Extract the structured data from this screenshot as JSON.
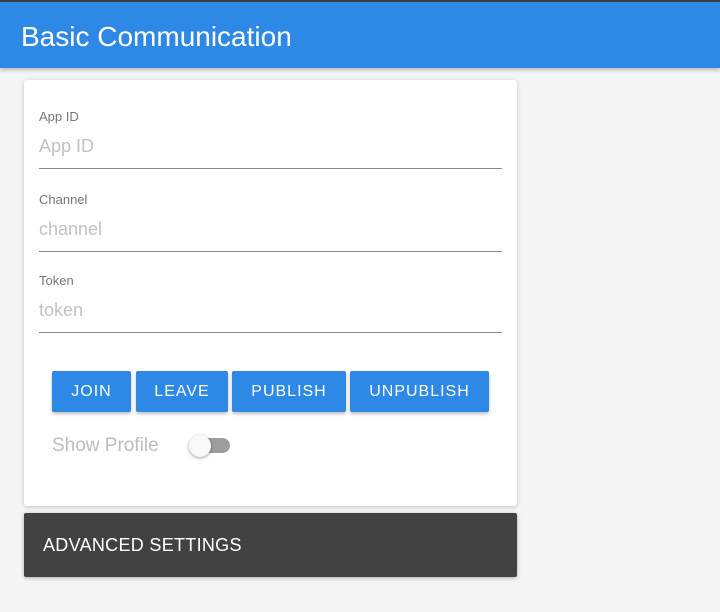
{
  "header": {
    "title": "Basic Communication"
  },
  "form": {
    "fields": [
      {
        "label": "App ID",
        "placeholder": "App ID",
        "value": ""
      },
      {
        "label": "Channel",
        "placeholder": "channel",
        "value": ""
      },
      {
        "label": "Token",
        "placeholder": "token",
        "value": ""
      }
    ],
    "buttons": {
      "join": "JOIN",
      "leave": "LEAVE",
      "publish": "PUBLISH",
      "unpublish": "UNPUBLISH"
    },
    "show_profile": {
      "label": "Show Profile",
      "checked": false
    }
  },
  "advanced_settings": {
    "label": "ADVANCED SETTINGS"
  },
  "colors": {
    "primary": "#2d89e5",
    "panel_dark": "#424242",
    "background": "#f5f5f5"
  }
}
